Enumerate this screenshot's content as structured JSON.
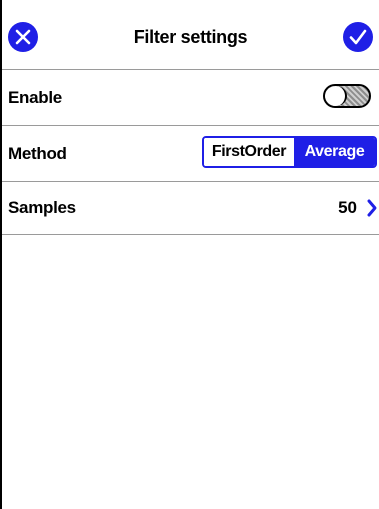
{
  "header": {
    "title": "Filter settings",
    "cancel_icon": "close-circle-icon",
    "confirm_icon": "check-circle-icon"
  },
  "rows": {
    "enable": {
      "label": "Enable",
      "toggle_on": false
    },
    "method": {
      "label": "Method",
      "options": [
        "FirstOrder",
        "Average"
      ],
      "selected": "Average"
    },
    "samples": {
      "label": "Samples",
      "value": "50",
      "icon": "chevron-right-icon"
    }
  },
  "colors": {
    "accent": "#1f1fe6",
    "divider": "#9a9a9a",
    "toggle_off_fill": "#8d8d8d"
  }
}
